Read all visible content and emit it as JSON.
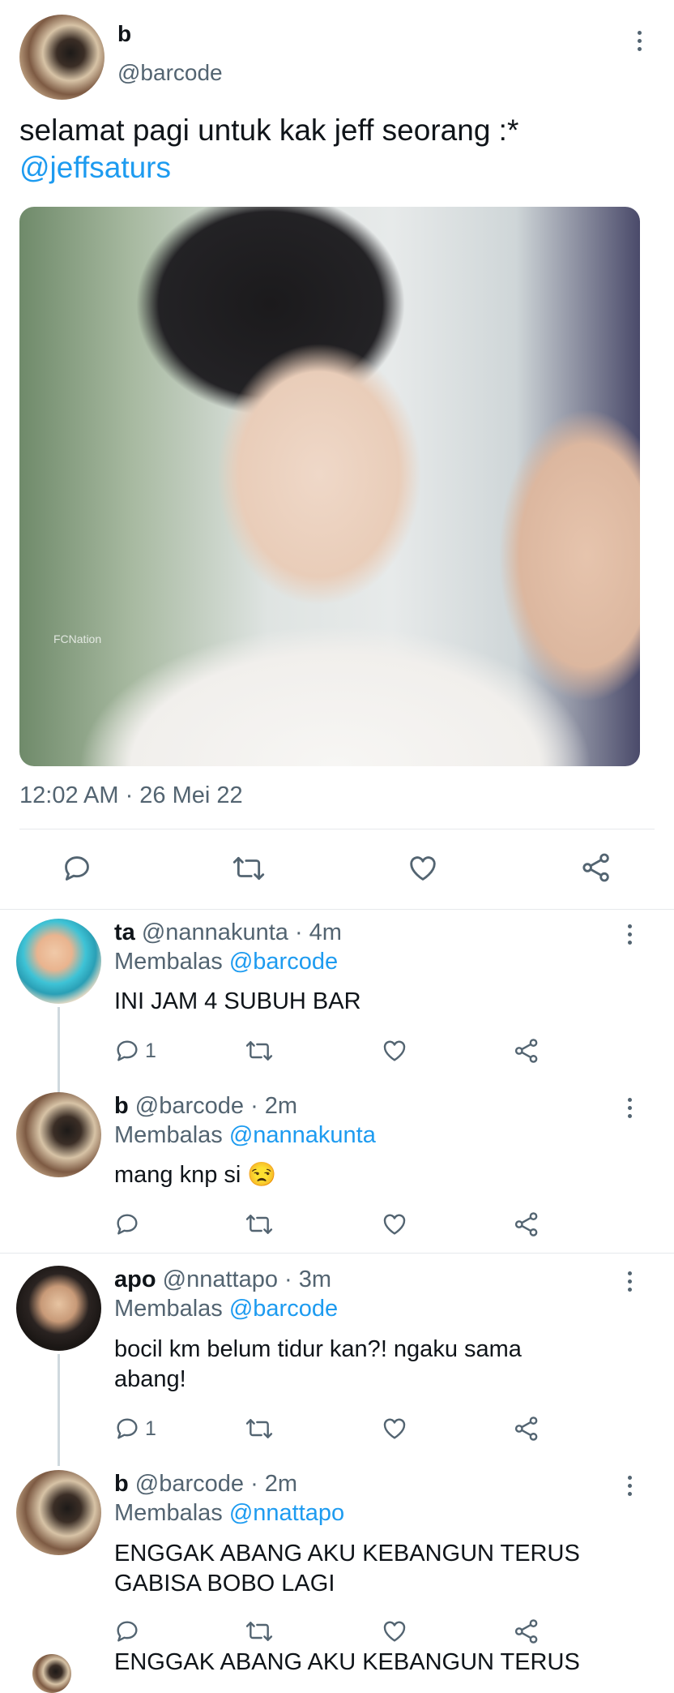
{
  "main_tweet": {
    "display_name": "b",
    "handle": "@barcode",
    "text": "selamat pagi untuk kak jeff seorang :*",
    "mention": "@jeffsaturs",
    "image_watermark": "FCNation",
    "timestamp": "12:02 AM · 26 Mei 22"
  },
  "replies": [
    {
      "display_name": "ta",
      "meta": "@nannakunta · 4m",
      "replying_label": "Membalas",
      "replying_to": "@barcode",
      "text": "INI JAM 4 SUBUH BAR",
      "reply_count": "1"
    },
    {
      "display_name": "b",
      "meta": "@barcode · 2m",
      "replying_label": "Membalas",
      "replying_to": "@nannakunta",
      "text": "mang knp si 😒",
      "reply_count": ""
    },
    {
      "display_name": "apo",
      "meta": "@nnattapo · 3m",
      "replying_label": "Membalas",
      "replying_to": "@barcode",
      "text_line1": "bocil km belum tidur kan?! ngaku sama",
      "text_line2": "abang!",
      "reply_count": "1"
    },
    {
      "display_name": "b",
      "meta": "@barcode · 2m",
      "replying_label": "Membalas",
      "replying_to": "@nnattapo",
      "text_line1": "ENGGAK ABANG AKU KEBANGUN TERUS",
      "text_line2": "GABISA BOBO LAGI",
      "reply_count": ""
    }
  ],
  "partial_text": "ENGGAK ABANG AKU KEBANGUN TERUS",
  "colors": {
    "accent": "#1d9bf0",
    "secondary_text": "#536471",
    "divider": "#e6e9ec"
  }
}
